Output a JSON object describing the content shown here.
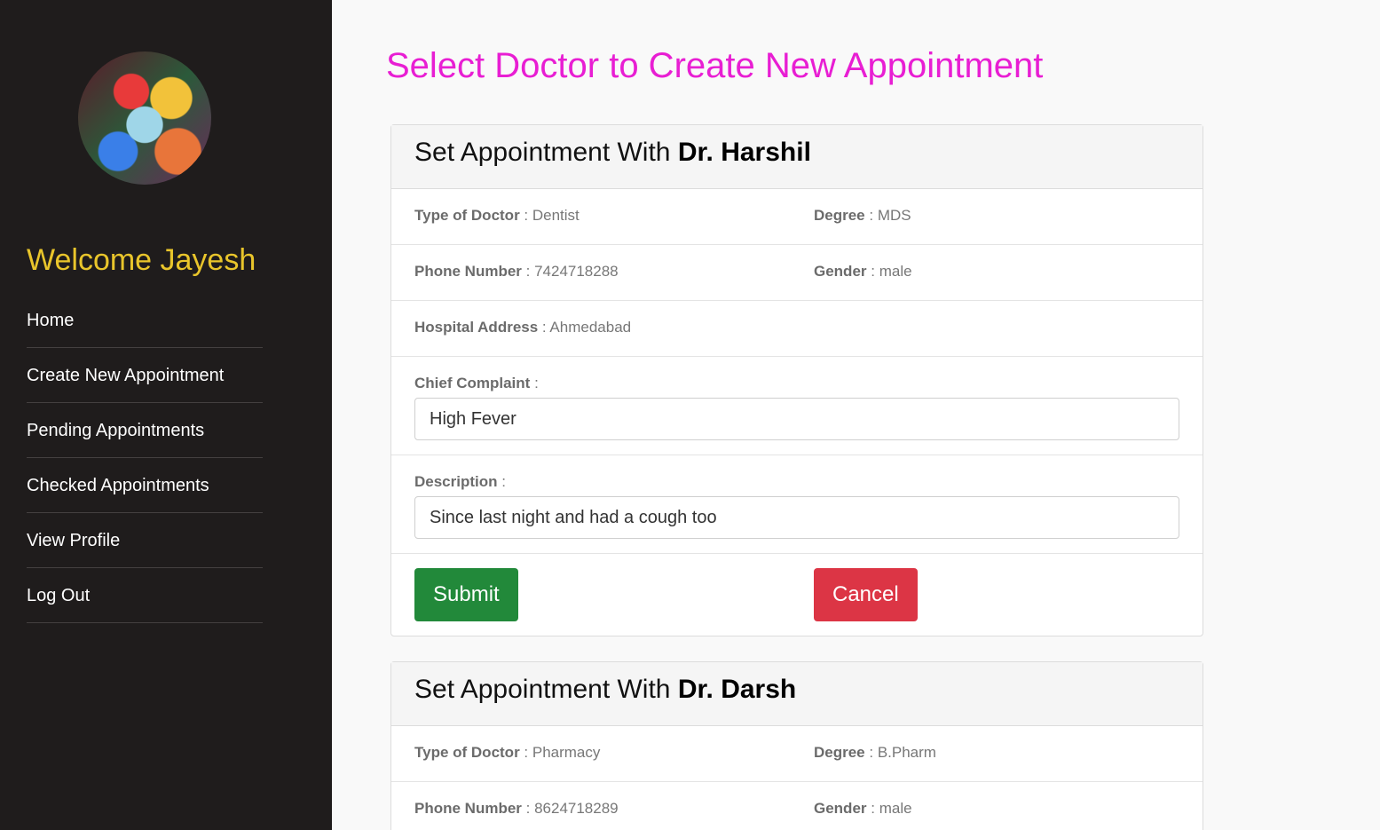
{
  "sidebar": {
    "welcome": "Welcome Jayesh",
    "nav": [
      {
        "label": "Home"
      },
      {
        "label": "Create New Appointment"
      },
      {
        "label": "Pending Appointments"
      },
      {
        "label": "Checked Appointments"
      },
      {
        "label": "View Profile"
      },
      {
        "label": "Log Out"
      }
    ]
  },
  "page": {
    "title": "Select Doctor to Create New Appointment"
  },
  "doctors": [
    {
      "header_prefix": "Set Appointment With",
      "name": "Dr. Harshil",
      "type_label": "Type of Doctor",
      "type_value": "Dentist",
      "degree_label": "Degree",
      "degree_value": "MDS",
      "phone_label": "Phone Number",
      "phone_value": "7424718288",
      "gender_label": "Gender",
      "gender_value": "male",
      "address_label": "Hospital Address",
      "address_value": "Ahmedabad",
      "complaint_label": "Chief Complaint",
      "complaint_value": "High Fever",
      "description_label": "Description",
      "description_value": "Since last night and had a cough too",
      "submit_label": "Submit",
      "cancel_label": "Cancel"
    },
    {
      "header_prefix": "Set Appointment With",
      "name": "Dr. Darsh",
      "type_label": "Type of Doctor",
      "type_value": "Pharmacy",
      "degree_label": "Degree",
      "degree_value": "B.Pharm",
      "phone_label": "Phone Number",
      "phone_value": "8624718289",
      "gender_label": "Gender",
      "gender_value": "male"
    }
  ],
  "colors": {
    "sidebar_bg": "#1f1c1c",
    "welcome": "#e9c52b",
    "title": "#e81ed3",
    "submit": "#22893a",
    "cancel": "#dc3545"
  }
}
